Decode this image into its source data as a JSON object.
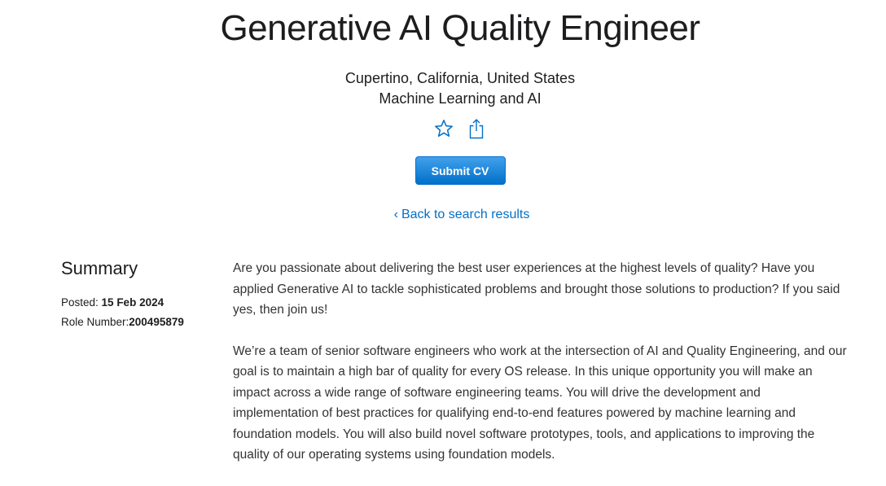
{
  "job": {
    "title": "Generative AI Quality Engineer",
    "location": "Cupertino, California, United States",
    "team": "Machine Learning and AI"
  },
  "icons": {
    "favorite": "star-icon",
    "share": "share-icon"
  },
  "submit": {
    "label": "Submit CV"
  },
  "back_link": {
    "chevron": "‹",
    "label": "Back to search results"
  },
  "summary": {
    "heading": "Summary",
    "posted_label": "Posted:",
    "posted_value": "15 Feb 2024",
    "role_label": "Role Number:",
    "role_value": "200495879",
    "paragraphs": [
      "Are you passionate about delivering the best user experiences at the highest levels of quality? Have you applied Generative AI to tackle sophisticated problems and brought those solutions to production? If you said yes, then join us!",
      "We’re a team of senior software engineers who work at the intersection of AI and Quality Engineering, and our goal is to maintain a high bar of quality for every OS release. In this unique opportunity you will make an impact across a wide range of software engineering teams. You will drive the development and implementation of best practices for qualifying end-to-end features powered by machine learning and foundation models. You will also build novel software prototypes, tools, and applications to improving the quality of our operating systems using foundation models."
    ]
  },
  "colors": {
    "accent": "#0070c9",
    "button_top": "#42a1ec",
    "button_bottom": "#0070c9",
    "text": "#1d1d1f"
  }
}
